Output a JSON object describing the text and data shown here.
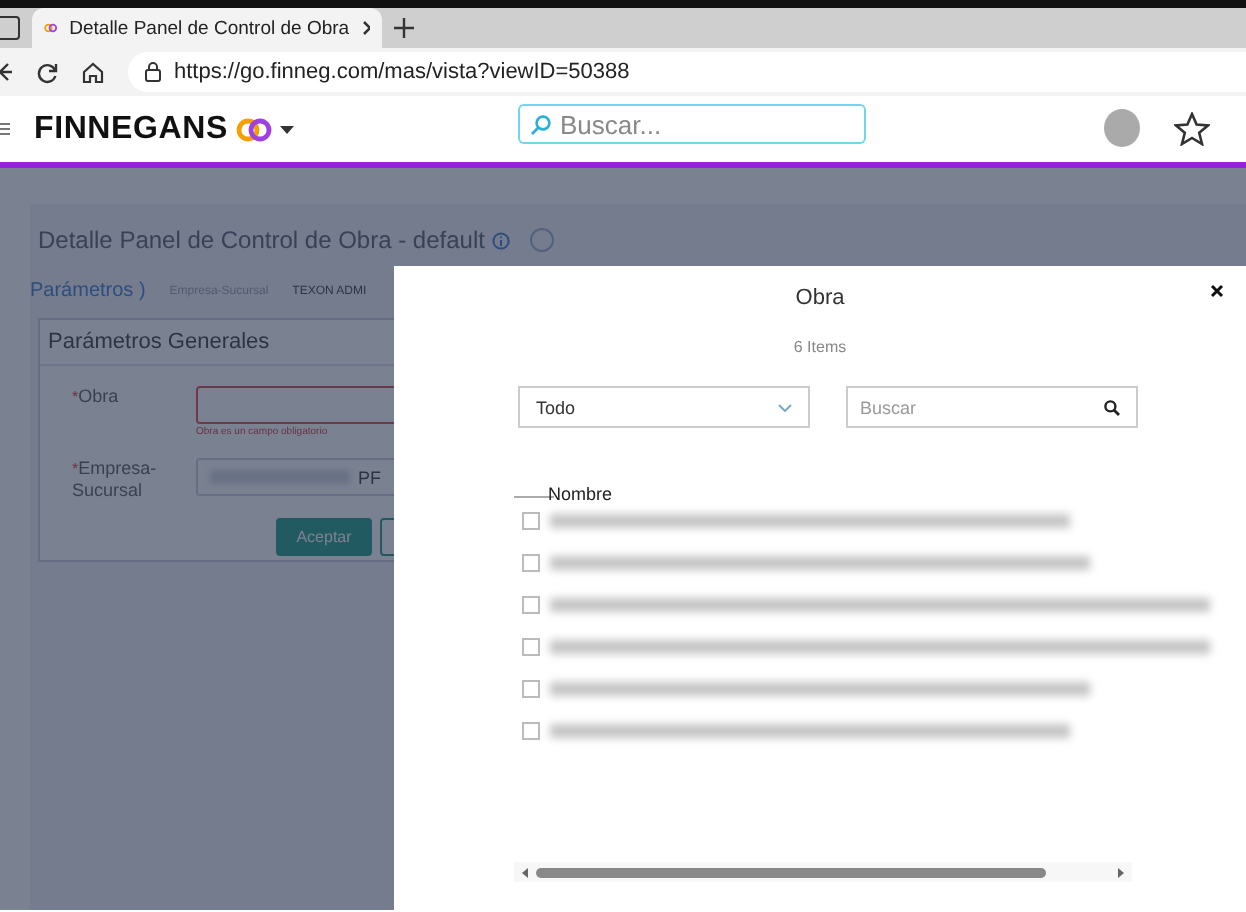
{
  "browser": {
    "tab_title": "Detalle Panel de Control de Obra",
    "url": "https://go.finneg.com/mas/vista?viewID=50388"
  },
  "app_header": {
    "brand": "FINNEGANS",
    "search_placeholder": "Buscar..."
  },
  "page": {
    "title": "Detalle Panel de Control de Obra - default",
    "params_tab": "Parámetros )",
    "filter_label": "Empresa-Sucursal",
    "filter_value": "TEXON ADMI",
    "section_title": "Parámetros Generales",
    "fields": [
      {
        "label": "Obra",
        "required_mark": "*",
        "invalid": true,
        "error": "Obra es un campo obligatorio"
      },
      {
        "label": "Empresa-Sucursal",
        "required_mark": "*",
        "invalid": false,
        "value": "PF"
      }
    ],
    "buttons": [
      {
        "kind": "primary",
        "label": "Aceptar"
      },
      {
        "kind": "outline"
      }
    ]
  },
  "modal": {
    "title": "Obra",
    "count": "6 Items",
    "filter_value": "Todo",
    "search_placeholder": "Buscar",
    "column": "Nombre",
    "rows": [
      {
        "checked": false
      },
      {
        "checked": false
      },
      {
        "checked": false
      },
      {
        "checked": false
      },
      {
        "checked": false
      },
      {
        "checked": false
      }
    ]
  }
}
